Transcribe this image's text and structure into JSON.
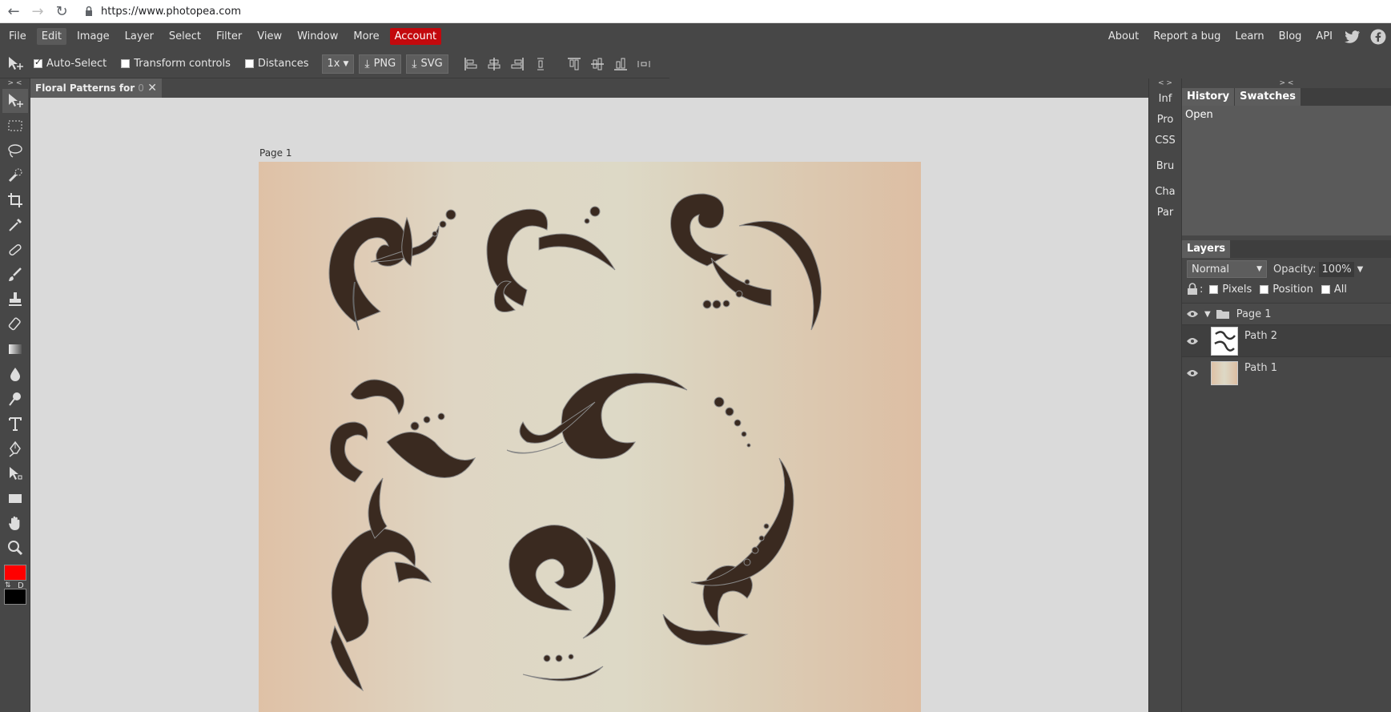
{
  "browser": {
    "url": "https://www.photopea.com"
  },
  "menubar": {
    "items": [
      "File",
      "Edit",
      "Image",
      "Layer",
      "Select",
      "Filter",
      "View",
      "Window",
      "More"
    ],
    "account": "Account",
    "right_links": [
      "About",
      "Report a bug",
      "Learn",
      "Blog",
      "API"
    ]
  },
  "options": {
    "auto_select": "Auto-Select",
    "transform_controls": "Transform controls",
    "distances": "Distances",
    "scale": "1x",
    "png": "PNG",
    "svg": "SVG"
  },
  "document": {
    "tab_title": "Floral Patterns for",
    "tab_title_faded": "0",
    "artboard_label": "Page 1"
  },
  "mini_panels": [
    "Inf",
    "Pro",
    "CSS",
    "Bru",
    "Cha",
    "Par"
  ],
  "right_panel": {
    "history_tab": "History",
    "swatches_tab": "Swatches",
    "history_items": [
      "Open"
    ],
    "layers_tab": "Layers",
    "blend_mode": "Normal",
    "opacity_label": "Opacity:",
    "opacity_value": "100%",
    "lock_pixels": "Pixels",
    "lock_position": "Position",
    "lock_all": "All",
    "layers": [
      {
        "name": "Page 1",
        "type": "group"
      },
      {
        "name": "Path 2",
        "type": "layer"
      },
      {
        "name": "Path 1",
        "type": "layer"
      }
    ]
  },
  "colors": {
    "foreground": "#ff0000",
    "background": "#000000",
    "ornament": "#3a2a20"
  },
  "collapse_labels": {
    "left": "> <",
    "mini": "< >",
    "right": "> <"
  }
}
